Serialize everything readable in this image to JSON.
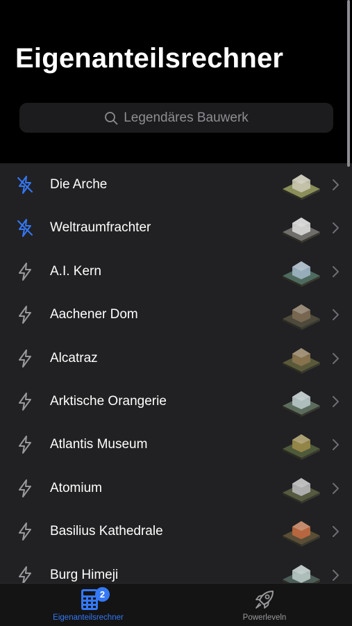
{
  "header": {
    "title": "Eigenanteilsrechner",
    "search": {
      "placeholder": "Legendäres Bauwerk",
      "icon": "search-icon"
    }
  },
  "list": {
    "items": [
      {
        "label": "Die Arche",
        "icon": "bolt-slash-icon",
        "active": true
      },
      {
        "label": "Weltraumfrachter",
        "icon": "bolt-slash-icon",
        "active": true
      },
      {
        "label": "A.I. Kern",
        "icon": "bolt-icon",
        "active": false
      },
      {
        "label": "Aachener Dom",
        "icon": "bolt-icon",
        "active": false
      },
      {
        "label": "Alcatraz",
        "icon": "bolt-icon",
        "active": false
      },
      {
        "label": "Arktische Orangerie",
        "icon": "bolt-icon",
        "active": false
      },
      {
        "label": "Atlantis Museum",
        "icon": "bolt-icon",
        "active": false
      },
      {
        "label": "Atomium",
        "icon": "bolt-icon",
        "active": false
      },
      {
        "label": "Basilius Kathedrale",
        "icon": "bolt-icon",
        "active": false
      },
      {
        "label": "Burg Himeji",
        "icon": "bolt-icon",
        "active": false
      }
    ]
  },
  "tabbar": {
    "tabs": [
      {
        "label": "Eigenanteilsrechner",
        "icon": "calculator-icon",
        "badge": "2",
        "selected": true
      },
      {
        "label": "Powerleveln",
        "icon": "rocket-icon",
        "selected": false
      }
    ]
  },
  "colors": {
    "accent": "#3478f6",
    "background": "#000000",
    "list_background": "#212123",
    "secondary_text": "#8e8e93"
  }
}
